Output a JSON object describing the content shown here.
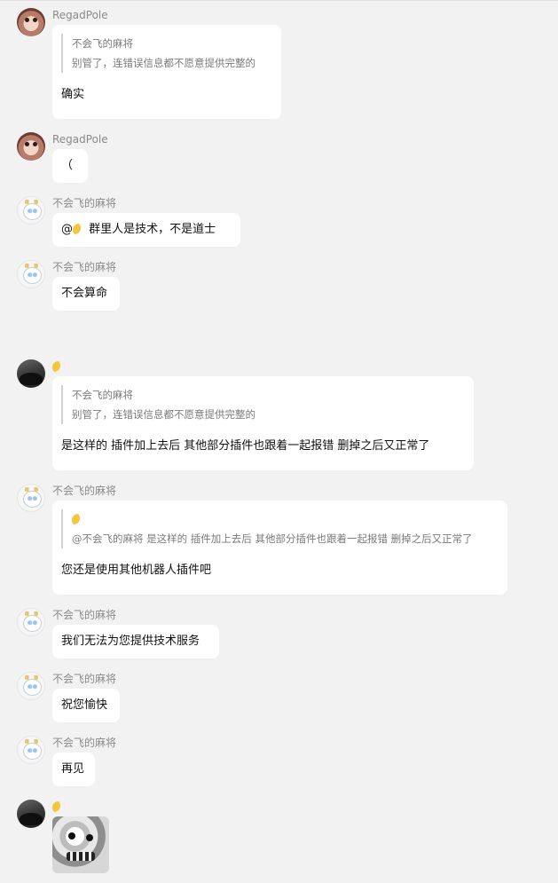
{
  "messages": [
    {
      "sender": "RegadPole",
      "avatar": "pink-face-avatar",
      "quote": {
        "author": "不会飞的麻将",
        "text": "别管了，连错误信息都不愿意提供完整的"
      },
      "text": "确实"
    },
    {
      "sender": "RegadPole",
      "avatar": "pink-face-avatar",
      "text": "（"
    },
    {
      "sender": "不会飞的麻将",
      "avatar": "cat-avatar",
      "mention": "@",
      "text": "群里人是技术，不是道士"
    },
    {
      "sender": "不会飞的麻将",
      "avatar": "cat-avatar",
      "text": "不会算命"
    },
    {
      "sender": "",
      "avatar": "dark-avatar",
      "quote": {
        "author": "不会飞的麻将",
        "text": "别管了，连错误信息都不愿意提供完整的"
      },
      "text": "是这样的  插件加上去后 其他部分插件也跟着一起报错  删掉之后又正常了"
    },
    {
      "sender": "不会飞的麻将",
      "avatar": "cat-avatar",
      "quote": {
        "author": "",
        "text": "@不会飞的麻将 是这样的 插件加上去后 其他部分插件也跟着一起报错 删掉之后又正常了"
      },
      "text": "您还是使用其他机器人插件吧"
    },
    {
      "sender": "不会飞的麻将",
      "avatar": "cat-avatar",
      "text": "我们无法为您提供技术服务"
    },
    {
      "sender": "不会飞的麻将",
      "avatar": "cat-avatar",
      "text": "祝您愉快"
    },
    {
      "sender": "不会飞的麻将",
      "avatar": "cat-avatar",
      "text": "再见"
    },
    {
      "sender": "",
      "avatar": "dark-avatar",
      "sticker": "grey-face-sticker"
    }
  ]
}
